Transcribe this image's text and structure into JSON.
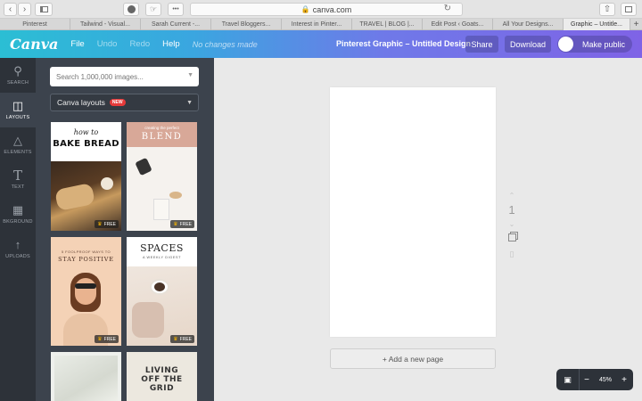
{
  "browser": {
    "url": "canva.com",
    "tabs": [
      {
        "label": "Pinterest",
        "active": false
      },
      {
        "label": "Tailwind - Visual...",
        "active": false
      },
      {
        "label": "Sarah Current -...",
        "active": false
      },
      {
        "label": "Travel Bloggers...",
        "active": false
      },
      {
        "label": "Interest in Pinter...",
        "active": false
      },
      {
        "label": "TRAVEL | BLOG |...",
        "active": false
      },
      {
        "label": "Edit Post ‹ Goats...",
        "active": false
      },
      {
        "label": "All Your Designs...",
        "active": false
      },
      {
        "label": "Graphic – Untitle...",
        "active": true
      }
    ]
  },
  "header": {
    "logo": "Canva",
    "menu": {
      "file": "File",
      "undo": "Undo",
      "redo": "Redo",
      "help": "Help"
    },
    "status": "No changes made",
    "design_title": "Pinterest Graphic – Untitled Design",
    "share_label": "Share",
    "download_label": "Download",
    "make_public_label": "Make public",
    "colors": {
      "gradient_start": "#2bbed4",
      "gradient_end": "#7f63e6"
    }
  },
  "rail": {
    "items": [
      {
        "label": "SEARCH",
        "icon": "search-icon"
      },
      {
        "label": "LAYOUTS",
        "icon": "layouts-icon"
      },
      {
        "label": "ELEMENTS",
        "icon": "elements-icon"
      },
      {
        "label": "TEXT",
        "icon": "text-icon"
      },
      {
        "label": "BKGROUND",
        "icon": "background-icon"
      },
      {
        "label": "UPLOADS",
        "icon": "uploads-icon"
      }
    ]
  },
  "panel": {
    "search_placeholder": "Search 1,000,000 images...",
    "layouts_label": "Canva layouts",
    "new_badge": "NEW",
    "free_label": "FREE",
    "cards": [
      {
        "line1": "how to",
        "line2": "BAKE BREAD"
      },
      {
        "line1": "creating the perfect",
        "line2": "BLEND"
      },
      {
        "line1": "5 FOOLPROOF WAYS TO",
        "line2": "STAY POSITIVE"
      },
      {
        "line1": "SPACES",
        "line2": "A WEEKLY DIGEST"
      },
      {
        "line1": "",
        "line2": ""
      },
      {
        "line1": "LIVING",
        "line2": "OFF THE",
        "line3": "GRID"
      }
    ]
  },
  "canvas": {
    "page_number": "1",
    "add_page_label": "+ Add a new page",
    "zoom": "45%"
  }
}
